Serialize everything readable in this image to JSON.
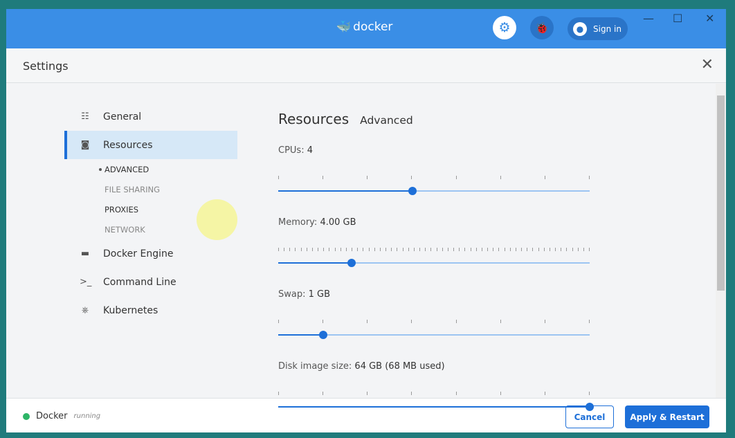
{
  "titlebar": {
    "logo_text": "docker",
    "sign_in": "Sign in",
    "minimize": "—",
    "maximize": "☐",
    "close": "✕"
  },
  "header": {
    "title": "Settings",
    "close": "✕"
  },
  "sidebar": {
    "items": [
      {
        "label": "General",
        "icon": "sliders-icon"
      },
      {
        "label": "Resources",
        "icon": "resources-icon",
        "active": true
      },
      {
        "label": "Docker Engine",
        "icon": "engine-icon"
      },
      {
        "label": "Command Line",
        "icon": "terminal-icon"
      },
      {
        "label": "Kubernetes",
        "icon": "kubernetes-icon"
      }
    ],
    "subitems": [
      "ADVANCED",
      "FILE SHARING",
      "PROXIES",
      "NETWORK"
    ]
  },
  "main": {
    "tabs": [
      "Resources",
      "Advanced"
    ],
    "settings": [
      {
        "label": "CPUs:",
        "value": "4",
        "fraction": 0.43
      },
      {
        "label": "Memory:",
        "value": "4.00 GB",
        "fraction": 0.235
      },
      {
        "label": "Swap:",
        "value": "1 GB",
        "fraction": 0.145
      },
      {
        "label": "Disk image size:",
        "value": "64 GB (68 MB used)",
        "fraction": 1.0
      }
    ]
  },
  "footer": {
    "app": "Docker",
    "status": "running",
    "cancel": "Cancel",
    "apply": "Apply & Restart"
  },
  "colors": {
    "accent": "#1d6fd8",
    "titlebar": "#3a8ee6",
    "running": "#2db567"
  }
}
